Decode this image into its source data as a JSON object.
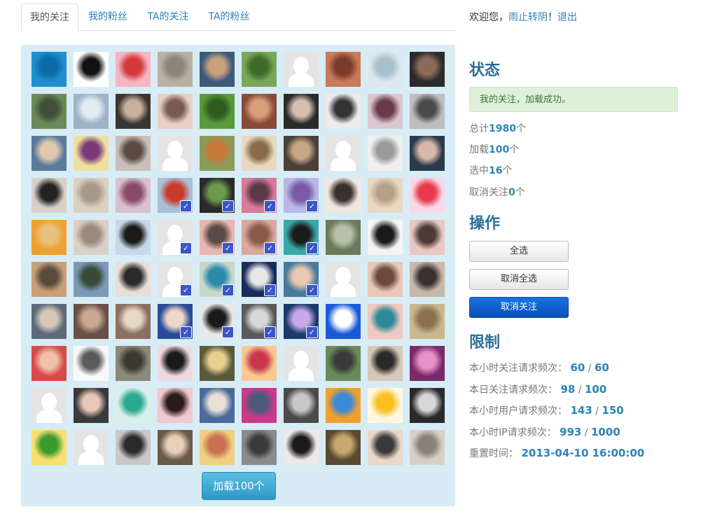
{
  "tabs": [
    {
      "label": "我的关注",
      "active": true
    },
    {
      "label": "我的粉丝",
      "active": false
    },
    {
      "label": "TA的关注",
      "active": false
    },
    {
      "label": "TA的粉丝",
      "active": false
    }
  ],
  "welcome": {
    "prefix": "欢迎您，",
    "username": "雨止转阴",
    "separator": "！",
    "logout": "退出"
  },
  "status": {
    "heading": "状态",
    "message": "我的关注，加载成功。",
    "total_label": "总计",
    "total_value": "1980",
    "total_unit": "个",
    "loaded_label": "加载",
    "loaded_value": "100",
    "loaded_unit": "个",
    "selected_label": "选中",
    "selected_value": "16",
    "selected_unit": "个",
    "unfollowed_label": "取消关注",
    "unfollowed_value": "0",
    "unfollowed_unit": "个"
  },
  "actions": {
    "heading": "操作",
    "select_all": "全选",
    "deselect_all": "取消全选",
    "unfollow": "取消关注"
  },
  "limits": {
    "heading": "限制",
    "hourly_follow_label": "本小时关注请求频次：",
    "hourly_follow_used": "60",
    "hourly_follow_max": "60",
    "daily_follow_label": "本日关注请求频次：",
    "daily_follow_used": "98",
    "daily_follow_max": "100",
    "hourly_user_label": "本小时用户请求频次：",
    "hourly_user_used": "143",
    "hourly_user_max": "150",
    "hourly_ip_label": "本小时IP请求频次：",
    "hourly_ip_used": "993",
    "hourly_ip_max": "1000",
    "reset_label": "重置时间：",
    "reset_value": "2013-04-10 16:00:00",
    "slash": "/"
  },
  "load_more": "加载100个",
  "avatars": [
    {
      "c": "#1f8fd0",
      "c2": "#0d6aa8"
    },
    {
      "c": "#ffffff",
      "c2": "#111111"
    },
    {
      "c": "#f4b6c2",
      "c2": "#d53a3a"
    },
    {
      "c": "#b8b2a6",
      "c2": "#8c8478"
    },
    {
      "c": "#3e5a7a",
      "c2": "#c9a27c"
    },
    {
      "c": "#7aa85a",
      "c2": "#3c6b2a"
    },
    {
      "c": "silhouette"
    },
    {
      "c": "#c87a5a",
      "c2": "#7a3b2a"
    },
    {
      "c": "#dce8f0",
      "c2": "#a8bfce"
    },
    {
      "c": "#2b2b2b",
      "c2": "#8a6b5a"
    },
    {
      "c": "#6b8a5a",
      "c2": "#3f4f3a"
    },
    {
      "c": "#9fb3c6",
      "c2": "#e4ecf2"
    },
    {
      "c": "#3a3530",
      "c2": "#c8b09a"
    },
    {
      "c": "#e8d0c8",
      "c2": "#7a5a50"
    },
    {
      "c": "#5a9a3a",
      "c2": "#2f5a20"
    },
    {
      "c": "#8a4a3a",
      "c2": "#d8a07a"
    },
    {
      "c": "#2a2a2a",
      "c2": "#d8c0b0"
    },
    {
      "c": "#ececec",
      "c2": "#333333"
    },
    {
      "c": "#d8c8d0",
      "c2": "#6a3a4a"
    },
    {
      "c": "#bdbdbd",
      "c2": "#4a4a4a"
    },
    {
      "c": "#5a7a9a",
      "c2": "#e0c8b0"
    },
    {
      "c": "#f0e0a0",
      "c2": "#7a3a7a"
    },
    {
      "c": "#c8c0b8",
      "c2": "#5a4a40"
    },
    {
      "c": "silhouette"
    },
    {
      "c": "#8a9a5a",
      "c2": "#c87a3a"
    },
    {
      "c": "#e8d8c0",
      "c2": "#8a6a4a"
    },
    {
      "c": "#4a4038",
      "c2": "#c8a888"
    },
    {
      "c": "silhouette"
    },
    {
      "c": "#f0f0f0",
      "c2": "#9a9a9a"
    },
    {
      "c": "#2a3a4a",
      "c2": "#d8b8a8"
    },
    {
      "c": "#d8d0c8",
      "c2": "#222222"
    },
    {
      "c": "#d8d0c0",
      "c2": "#a89888"
    },
    {
      "c": "#d8c0d0",
      "c2": "#8a4a6a"
    },
    {
      "c": "#a8c0d8",
      "c2": "#c83a2a",
      "check": true
    },
    {
      "c": "#2a2a2a",
      "c2": "#6a9a4a",
      "check": true
    },
    {
      "c": "#d87a9a",
      "c2": "#5a3a4a",
      "check": true
    },
    {
      "c": "#b8b8e8",
      "c2": "#7a5aa8",
      "check": true
    },
    {
      "c": "#f0e8e0",
      "c2": "#3a3030"
    },
    {
      "c": "#e8d8c0",
      "c2": "#b8a088"
    },
    {
      "c": "#f8d8e8",
      "c2": "#e83a4a"
    },
    {
      "c": "#f0a030",
      "c2": "#e8c080"
    },
    {
      "c": "#d8d0c8",
      "c2": "#9a8a7a"
    },
    {
      "c": "#c8d8e8",
      "c2": "#1a1a1a"
    },
    {
      "c": "silhouette",
      "check": true
    },
    {
      "c": "#e8b8b0",
      "c2": "#5a4a48",
      "check": true
    },
    {
      "c": "#d8a8a0",
      "c2": "#8a5a4a",
      "check": true
    },
    {
      "c": "#3aa8a8",
      "c2": "#1a1a1a",
      "check": true
    },
    {
      "c": "#6a7a5a",
      "c2": "#b8c0a8"
    },
    {
      "c": "#f4f4f4",
      "c2": "#1a1a1a"
    },
    {
      "c": "#e8c8c0",
      "c2": "#4a3a38"
    },
    {
      "c": "#c8a078",
      "c2": "#5a4a3a"
    },
    {
      "c": "#7a9ab8",
      "c2": "#3a4a38"
    },
    {
      "c": "#e8e0d8",
      "c2": "#2a2a2a"
    },
    {
      "c": "silhouette",
      "check": true
    },
    {
      "c": "#c8d8c8",
      "c2": "#2a8aa8",
      "check": true
    },
    {
      "c": "#1a2a5a",
      "c2": "#e8e8e8",
      "check": true
    },
    {
      "c": "#4a7a9a",
      "c2": "#e8c8b0",
      "check": true
    },
    {
      "c": "silhouette"
    },
    {
      "c": "#e8c8b8",
      "c2": "#6a4a40"
    },
    {
      "c": "#c8b8a8",
      "c2": "#3a3030"
    },
    {
      "c": "#5a6a7a",
      "c2": "#d8c8b8"
    },
    {
      "c": "#6a5048",
      "c2": "#c8a890"
    },
    {
      "c": "#8a7060",
      "c2": "#e8d8c8"
    },
    {
      "c": "#2a4a9a",
      "c2": "#f0d8c8",
      "check": true
    },
    {
      "c": "#e8e8e8",
      "c2": "#1a1a1a",
      "check": true
    },
    {
      "c": "#5a5a5a",
      "c2": "#d8d8d8",
      "check": true
    },
    {
      "c": "#1a3a6a",
      "c2": "#c8a8e8",
      "check": true
    },
    {
      "c": "#1a5ad8",
      "c2": "#ffffff"
    },
    {
      "c": "#f0c8c0",
      "c2": "#2a8a9a"
    },
    {
      "c": "#c8b890",
      "c2": "#8a7050"
    },
    {
      "c": "#d84a4a",
      "c2": "#f0c0a8"
    },
    {
      "c": "#f8f8f8",
      "c2": "#5a5a5a"
    },
    {
      "c": "#8a8a78",
      "c2": "#3a3a30"
    },
    {
      "c": "#f0d8e0",
      "c2": "#1a1a1a"
    },
    {
      "c": "#5a5a3a",
      "c2": "#e8d090"
    },
    {
      "c": "#f8c890",
      "c2": "#c8384a"
    },
    {
      "c": "silhouette"
    },
    {
      "c": "#6a8a5a",
      "c2": "#3a3a3a"
    },
    {
      "c": "#d8c8b8",
      "c2": "#2a2a2a"
    },
    {
      "c": "#7a2a6a",
      "c2": "#e890c8"
    },
    {
      "c": "silhouette"
    },
    {
      "c": "#3a3a3a",
      "c2": "#e8c8b8"
    },
    {
      "c": "#d8f0e8",
      "c2": "#2aa890"
    },
    {
      "c": "#f0c8d0",
      "c2": "#2a1a1a"
    },
    {
      "c": "#4a6a9a",
      "c2": "#e8e0d8"
    },
    {
      "c": "#c83a8a",
      "c2": "#4a5a7a"
    },
    {
      "c": "#4a4a4a",
      "c2": "#c8c8c8"
    },
    {
      "c": "#f0a030",
      "c2": "#3a8ad8"
    },
    {
      "c": "#fff8e0",
      "c2": "#f8c020"
    },
    {
      "c": "#2a2a2a",
      "c2": "#d8d8d8"
    },
    {
      "c": "#f8e070",
      "c2": "#3a9a2a"
    },
    {
      "c": "silhouette"
    },
    {
      "c": "#c8c8c8",
      "c2": "#2a2a2a"
    },
    {
      "c": "#6a5a48",
      "c2": "#e8d0b8"
    },
    {
      "c": "#f0d080",
      "c2": "#c87050"
    },
    {
      "c": "#8a8a8a",
      "c2": "#3a3a3a"
    },
    {
      "c": "#f0e8e8",
      "c2": "#1a1a1a"
    },
    {
      "c": "#5a4a30",
      "c2": "#c8a870"
    },
    {
      "c": "#e8d8c8",
      "c2": "#3a3a3a"
    },
    {
      "c": "#d8d0c8",
      "c2": "#8a8078"
    }
  ]
}
